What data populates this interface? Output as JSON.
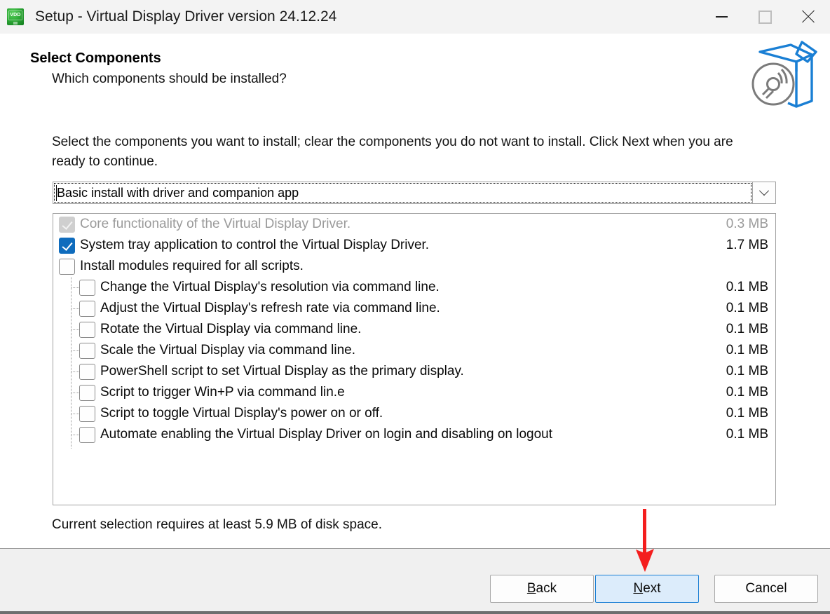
{
  "window": {
    "title": "Setup - Virtual Display Driver version 24.12.24",
    "app_icon": "vdd-monitor-icon",
    "icon_text": "VDD",
    "controls": {
      "minimize": "minimize-icon",
      "maximize": "maximize-icon",
      "close": "close-icon"
    }
  },
  "header": {
    "title": "Select Components",
    "subtitle": "Which components should be installed?",
    "icon": "open-box-with-disc-icon"
  },
  "body": {
    "intro": "Select the components you want to install; clear the components you do not want to install. Click Next when you are ready to continue.",
    "disk_note": "Current selection requires at least 5.9 MB of disk space."
  },
  "combo": {
    "value": "Basic install with driver and companion app",
    "caret_visible": true,
    "dropdown_icon": "chevron-down-icon"
  },
  "components": [
    {
      "label": "Core functionality of the Virtual Display Driver.",
      "size": "0.3 MB",
      "state": "checked-disabled",
      "level": 0
    },
    {
      "label": "System tray application to control the Virtual Display Driver.",
      "size": "1.7 MB",
      "state": "checked",
      "level": 0
    },
    {
      "label": "Install modules required for all scripts.",
      "size": "",
      "state": "unchecked",
      "level": 0
    },
    {
      "label": "Change the Virtual Display's resolution via command line.",
      "size": "0.1 MB",
      "state": "unchecked",
      "level": 1
    },
    {
      "label": "Adjust the Virtual Display's refresh rate via command line.",
      "size": "0.1 MB",
      "state": "unchecked",
      "level": 1
    },
    {
      "label": "Rotate the Virtual Display via command line.",
      "size": "0.1 MB",
      "state": "unchecked",
      "level": 1
    },
    {
      "label": "Scale the Virtual Display via command line.",
      "size": "0.1 MB",
      "state": "unchecked",
      "level": 1
    },
    {
      "label": "PowerShell script to set Virtual Display as the primary display.",
      "size": "0.1 MB",
      "state": "unchecked",
      "level": 1
    },
    {
      "label": "Script to trigger Win+P via command lin.e",
      "size": "0.1 MB",
      "state": "unchecked",
      "level": 1
    },
    {
      "label": "Script to toggle Virtual Display's power on or off.",
      "size": "0.1 MB",
      "state": "unchecked",
      "level": 1
    },
    {
      "label": "Automate enabling the Virtual Display Driver on login and disabling on logout",
      "size": "0.1 MB",
      "state": "unchecked",
      "level": 1
    }
  ],
  "buttons": {
    "back": {
      "accel": "B",
      "rest": "ack",
      "default": false
    },
    "next": {
      "accel": "N",
      "rest": "ext",
      "default": true
    },
    "cancel": {
      "label": "Cancel",
      "default": false
    }
  },
  "annotation": {
    "arrow": "red-down-arrow",
    "color": "#f41e1e",
    "points_at": "next-button"
  },
  "colors": {
    "accent_blue": "#0f6cbd",
    "default_button_fill": "#dcecfb",
    "default_button_border": "#1a7fd4",
    "titlebar": "#f3f3f3",
    "footer": "#f0f0f0",
    "disabled_text": "#9a9a9a"
  }
}
